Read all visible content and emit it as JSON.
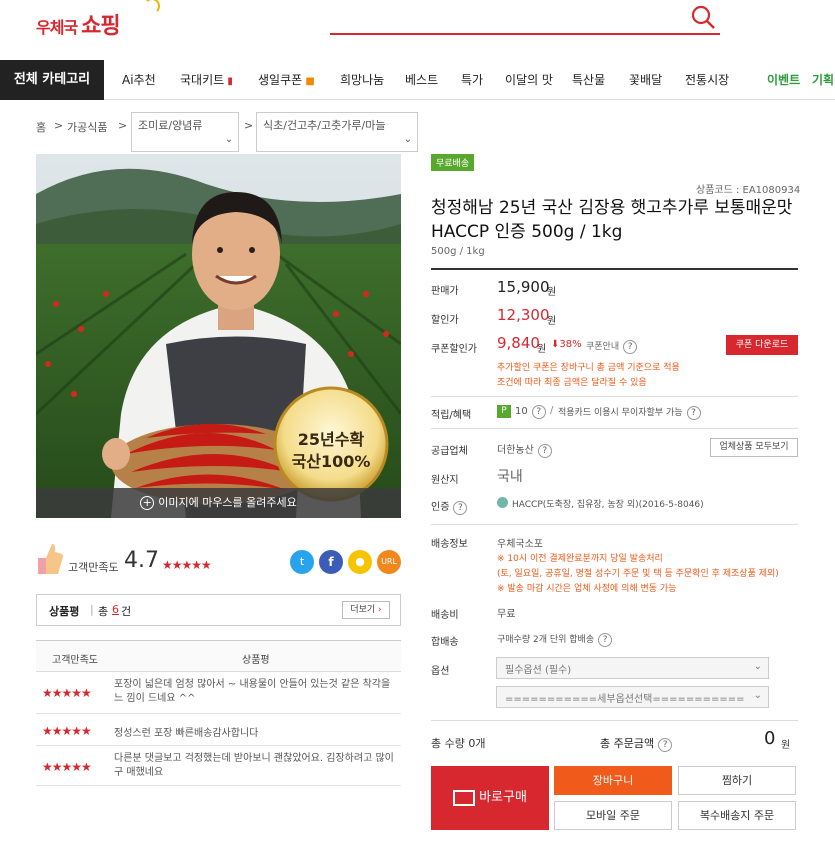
{
  "header": {
    "logo_text1": "우체국",
    "logo_text2": "쇼핑",
    "search_placeholder": ""
  },
  "nav": {
    "all_categories": "전체 카테고리",
    "items": [
      "Ai추천",
      "국대키트",
      "생일쿠폰",
      "희망나눔",
      "베스트",
      "특가",
      "이달의 맛",
      "특산물",
      "꽃배달",
      "전통시장"
    ],
    "extra": [
      "이벤트",
      "기획"
    ]
  },
  "breadcrumb": {
    "home": "홈",
    "sep": ">",
    "level1": "가공식품",
    "level2": "조미료/양념류",
    "level3": "식초/건고추/고춧가루/마늘"
  },
  "image": {
    "badge_line1": "25년수확",
    "badge_line2": "국산100%",
    "hover_text": "이미지에 마우스를 올려주세요"
  },
  "rating": {
    "label": "고객만족도",
    "value": "4.7",
    "stars": "★★★★★",
    "share_icons": [
      "twitter-icon",
      "facebook-icon",
      "kakao-icon",
      "url-icon"
    ],
    "url_label": "URL"
  },
  "review_box": {
    "title": "상품평",
    "sep": "|",
    "total_label": "총",
    "total_num": "6",
    "total_unit": "건",
    "more": "더보기"
  },
  "review_table": {
    "col1": "고객만족도",
    "col2": "상품평",
    "rows": [
      {
        "stars": "★★★★★",
        "text": "포장이 넓은데 엄청 많아서 ~ 내용물이 안들어 있는것 같은 착각을 느 낌이 드네요 ^^"
      },
      {
        "stars": "★★★★★",
        "text": "정성스런 포장 빠른배송감사합니다"
      },
      {
        "stars": "★★★★★",
        "text": "다른분 댓글보고 걱정했는데 받아보니 괜찮았어요. 김장하려고 많이 구 매했네요"
      }
    ]
  },
  "product": {
    "free_shipping": "무료배송",
    "code": "상품코드 : EA1080934",
    "title": "청정해남 25년 국산 김장용 햇고추가루 보통매운맛 HACCP 인증 500g / 1kg",
    "subtitle": "500g / 1kg"
  },
  "price": {
    "sale_label": "판매가",
    "sale_value": "15,900",
    "won": "원",
    "discount_label": "할인가",
    "discount_value": "12,300",
    "coupon_label": "쿠폰할인가",
    "coupon_value": "9,840",
    "coupon_pct": "38%",
    "coupon_info": "쿠폰안내",
    "coupon_btn": "쿠폰 다운로드",
    "coupon_note": "추가할인 쿠폰은 장바구니 총 금액 기준으로 적용 조건에 따라 최종 금액은 달라질 수 있음"
  },
  "benefit": {
    "label": "적립/혜택",
    "points": "10",
    "note": "적용카드 이용시 무이자할부 가능"
  },
  "supplier": {
    "label": "공급업체",
    "name": "더한농산",
    "btn": "업체상품 모두보기"
  },
  "origin": {
    "label": "원산지",
    "value": "국내"
  },
  "cert": {
    "label": "인증",
    "value": "HACCP(도축장, 집유장, 농장 외)(2016-5-8046)"
  },
  "shipping": {
    "label": "배송정보",
    "carrier": "우체국소포",
    "line1": "※ 10시 이전 결제완료분까지 당일 발송처리",
    "line2": "(토, 일요일, 공휴일, 명절 성수기 주문 및 택 등 주문확인 후 제조상품 제외)",
    "line3": "※ 발송 마감 시간은 업체 사정에 의해 변동 가능"
  },
  "fee": {
    "label": "배송비",
    "value": "무료"
  },
  "combine": {
    "label": "합배송",
    "value": "구매수량 2개 단위 합배송"
  },
  "options": {
    "label": "옵션",
    "opt1": "필수옵션 (필수)",
    "opt2": "===========세부옵션선택==========="
  },
  "total": {
    "qty_label": "총 수량",
    "qty_value": "0개",
    "amount_label": "총 주문금액",
    "amount_value": "0",
    "won": "원"
  },
  "buttons": {
    "buy_now": "바로구매",
    "cart": "장바구니",
    "wish": "찜하기",
    "mobile": "모바일 주문",
    "multi": "복수배송지 주문"
  },
  "colors": {
    "brand_red": "#d7282f",
    "orange": "#f05a1a",
    "green": "#58a82e"
  }
}
